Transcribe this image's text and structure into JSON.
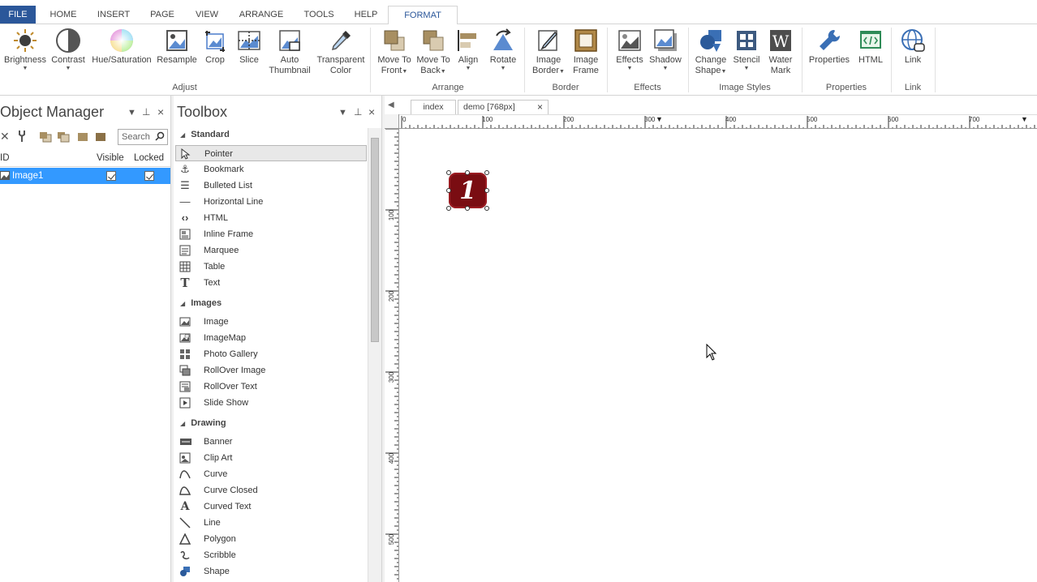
{
  "tabs": [
    {
      "label": "FILE"
    },
    {
      "label": "HOME"
    },
    {
      "label": "INSERT"
    },
    {
      "label": "PAGE"
    },
    {
      "label": "VIEW"
    },
    {
      "label": "ARRANGE"
    },
    {
      "label": "TOOLS"
    },
    {
      "label": "HELP"
    },
    {
      "label": "FORMAT"
    }
  ],
  "ribbon": {
    "adjust": {
      "brightness": "Brightness",
      "contrast": "Contrast",
      "hue": "Hue/Saturation",
      "resample": "Resample",
      "crop": "Crop",
      "slice": "Slice",
      "auto1": "Auto",
      "auto2": "Thumbnail",
      "trans1": "Transparent",
      "trans2": "Color",
      "label": "Adjust"
    },
    "arrange": {
      "mtf1": "Move To",
      "mtf2": "Front",
      "mtb1": "Move To",
      "mtb2": "Back",
      "align": "Align",
      "rotate": "Rotate",
      "label": "Arrange"
    },
    "border": {
      "ib1": "Image",
      "ib2": "Border",
      "if1": "Image",
      "if2": "Frame",
      "label": "Border"
    },
    "effects": {
      "effects": "Effects",
      "shadow": "Shadow",
      "label": "Effects"
    },
    "styles": {
      "cs1": "Change",
      "cs2": "Shape",
      "stencil": "Stencil",
      "wm1": "Water",
      "wm2": "Mark",
      "label": "Image Styles"
    },
    "properties": {
      "properties": "Properties",
      "html": "HTML",
      "label": "Properties"
    },
    "link": {
      "link": "Link",
      "label": "Link"
    }
  },
  "object_manager": {
    "title": "Object Manager",
    "search_placeholder": "Search",
    "columns": {
      "id": "ID",
      "visible": "Visible",
      "locked": "Locked"
    },
    "rows": [
      {
        "id": "Image1",
        "visible": true,
        "locked": true
      }
    ]
  },
  "toolbox": {
    "title": "Toolbox",
    "sections": {
      "standard": "Standard",
      "images": "Images",
      "drawing": "Drawing"
    },
    "standard_items": [
      "Pointer",
      "Bookmark",
      "Bulleted List",
      "Horizontal Line",
      "HTML",
      "Inline Frame",
      "Marquee",
      "Table",
      "Text"
    ],
    "image_items": [
      "Image",
      "ImageMap",
      "Photo Gallery",
      "RollOver Image",
      "RollOver Text",
      "Slide Show"
    ],
    "drawing_items": [
      "Banner",
      "Clip Art",
      "Curve",
      "Curve Closed",
      "Curved Text",
      "Line",
      "Polygon",
      "Scribble",
      "Shape"
    ]
  },
  "document": {
    "tabs": [
      {
        "label": "index"
      },
      {
        "label": "demo [768px]"
      }
    ],
    "close_glyph": "×",
    "ruler_h": [
      "0",
      "100",
      "200",
      "300",
      "400",
      "500",
      "600",
      "700"
    ],
    "ruler_v": [
      "100",
      "200",
      "300",
      "400",
      "500"
    ],
    "badge_text": "1"
  },
  "colors": {
    "file_tab": "#2b579a",
    "selection": "#3399ff",
    "badge": "#7a0d12"
  }
}
